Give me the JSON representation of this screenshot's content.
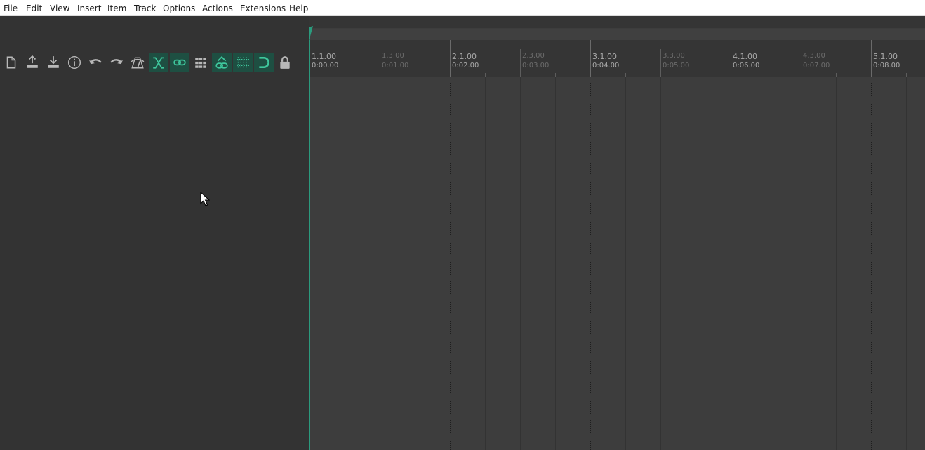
{
  "menubar": {
    "items": [
      "File",
      "Edit",
      "View",
      "Insert",
      "Item",
      "Track",
      "Options",
      "Actions",
      "Extensions",
      "Help"
    ]
  },
  "toolbar": {
    "buttons": [
      {
        "icon": "new-project-icon",
        "active": false
      },
      {
        "icon": "open-project-icon",
        "active": false
      },
      {
        "icon": "save-project-icon",
        "active": false
      },
      {
        "icon": "project-settings-icon",
        "active": false
      },
      {
        "icon": "undo-icon",
        "active": false
      },
      {
        "icon": "redo-icon",
        "active": false
      },
      {
        "icon": "metronome-icon",
        "active": false
      },
      {
        "icon": "auto-crossfade-icon",
        "active": true
      },
      {
        "icon": "envelope-points-move-icon",
        "active": true
      },
      {
        "icon": "item-grouping-icon",
        "active": false
      },
      {
        "icon": "ripple-edit-icon",
        "active": true
      },
      {
        "icon": "grid-icon",
        "active": true
      },
      {
        "icon": "snap-icon",
        "active": true
      },
      {
        "icon": "locking-icon",
        "active": false
      }
    ]
  },
  "ruler": {
    "marks": [
      {
        "beat": "1.1.00",
        "time": "0:00.00",
        "major": true
      },
      {
        "beat": "1.3.00",
        "time": "0:01.00",
        "major": false
      },
      {
        "beat": "2.1.00",
        "time": "0:02.00",
        "major": true
      },
      {
        "beat": "2.3.00",
        "time": "0:03.00",
        "major": false
      },
      {
        "beat": "3.1.00",
        "time": "0:04.00",
        "major": true
      },
      {
        "beat": "3.3.00",
        "time": "0:05.00",
        "major": false
      },
      {
        "beat": "4.1.00",
        "time": "0:06.00",
        "major": true
      },
      {
        "beat": "4.3.00",
        "time": "0:07.00",
        "major": false
      },
      {
        "beat": "5.1.00",
        "time": "0:08.00",
        "major": true
      }
    ]
  },
  "colors": {
    "accent": "#2b9b7e",
    "toggle_on_bg": "#1e4f42",
    "icon": "#b8b8b8",
    "icon_active": "#3fc79d",
    "tcp_bg": "#333333",
    "arrange_bg": "#3d3d3d"
  }
}
